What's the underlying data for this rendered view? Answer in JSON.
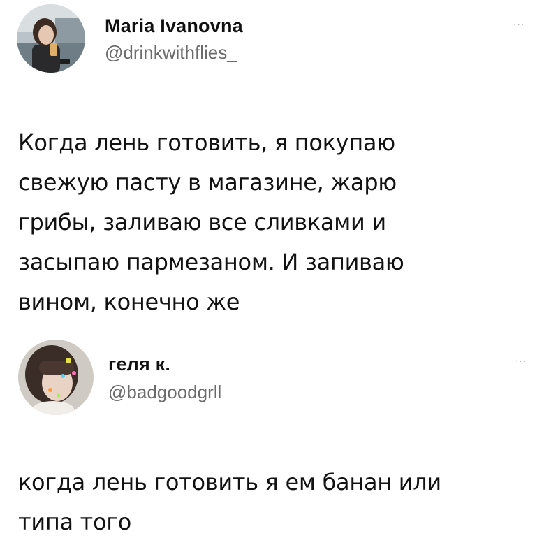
{
  "tweets": [
    {
      "display_name": "Maria Ivanovna",
      "handle": "@drinkwithflies_",
      "more_icon": "more-dots-icon",
      "more_label": "···",
      "text_lines": [
        "Когда лень готовить, я покупаю",
        "свежую пасту в магазине, жарю",
        "грибы, заливаю все сливками и",
        "засыпаю пармезаном. И запиваю",
        "вином, конечно же"
      ]
    },
    {
      "display_name": "геля к.",
      "handle": "@badgoodgrll",
      "more_icon": "more-dots-icon",
      "more_label": "···",
      "text_lines": [
        "когда лень готовить я ем банан или",
        "типа того"
      ]
    }
  ]
}
